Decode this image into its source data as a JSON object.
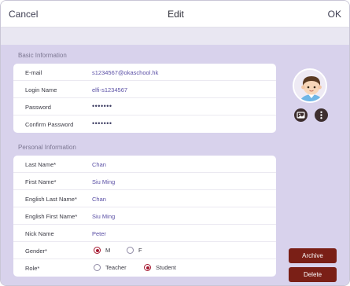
{
  "header": {
    "cancel_label": "Cancel",
    "title": "Edit",
    "ok_label": "OK"
  },
  "basic": {
    "title": "Basic Information",
    "rows": [
      {
        "label": "E-mail",
        "value": "s1234567@okaschool.hk"
      },
      {
        "label": "Login Name",
        "value": "elfi-s1234567"
      },
      {
        "label": "Password",
        "value": "•••••••"
      },
      {
        "label": "Confirm Password",
        "value": "•••••••"
      }
    ]
  },
  "personal": {
    "title": "Personal Information",
    "rows": [
      {
        "label": "Last Name*",
        "value": "Chan"
      },
      {
        "label": "First Name*",
        "value": "Siu Ming"
      },
      {
        "label": "English Last Name*",
        "value": "Chan"
      },
      {
        "label": "English First Name*",
        "value": "Siu Ming"
      },
      {
        "label": "Nick Name",
        "value": "Peter"
      }
    ],
    "gender": {
      "label": "Gender*",
      "options": [
        "M",
        "F"
      ],
      "selected": "M"
    },
    "role": {
      "label": "Role*",
      "options": [
        "Teacher",
        "Student"
      ],
      "selected": "Student"
    }
  },
  "sidebar": {
    "archive_label": "Archive",
    "delete_label": "Delete"
  },
  "icons": {
    "avatar": "student-avatar",
    "photo": "photo-icon",
    "more": "more-vertical-icon"
  },
  "colors": {
    "accent": "#a51830",
    "button": "#7a1f16",
    "background": "#d8d2ec",
    "value_text": "#5a4fa5"
  }
}
